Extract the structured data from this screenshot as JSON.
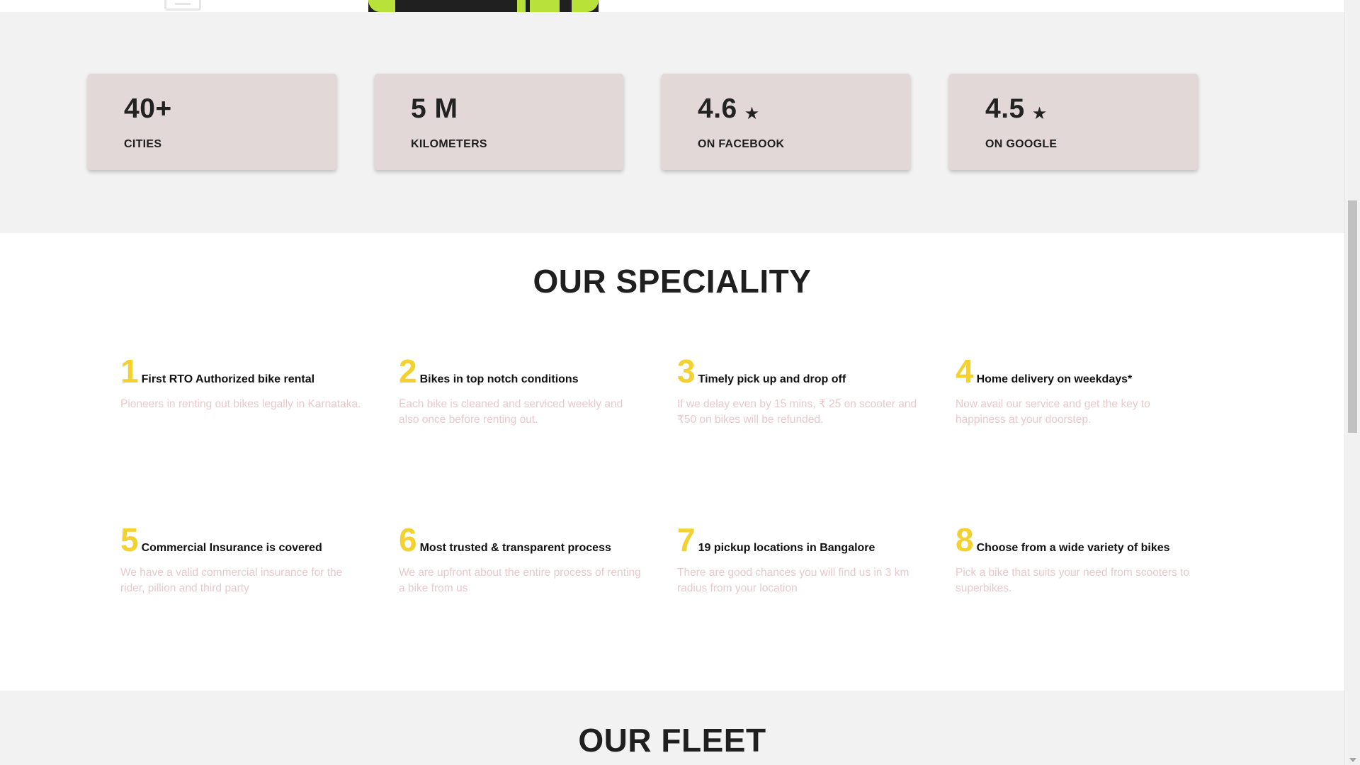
{
  "stats": [
    {
      "value": "40+",
      "label": "CITIES",
      "star": false
    },
    {
      "value": "5 M",
      "label": "KILOMETERS",
      "star": false
    },
    {
      "value": "4.6",
      "label": "ON FACEBOOK",
      "star": true
    },
    {
      "value": "4.5",
      "label": "ON GOOGLE",
      "star": true
    }
  ],
  "star_glyph": "★",
  "speciality": {
    "title": "OUR SPECIALITY",
    "items": [
      {
        "num": "1",
        "title": "First RTO Authorized bike rental",
        "desc": "Pioneers in renting out bikes legally in Karnataka."
      },
      {
        "num": "2",
        "title": "Bikes in top notch conditions",
        "desc": "Each bike is cleaned and serviced weekly and also once before renting out."
      },
      {
        "num": "3",
        "title": "Timely pick up and drop off",
        "desc": "If we delay even by 15 mins, ₹ 25 on scooter and ₹50 on bikes will be refunded."
      },
      {
        "num": "4",
        "title": "Home delivery on weekdays*",
        "desc": "Now avail our service and get the key to happiness at your doorstep."
      },
      {
        "num": "5",
        "title": "Commercial Insurance is covered",
        "desc": "We have a valid commercial insurance for the rider, pillion and third party"
      },
      {
        "num": "6",
        "title": "Most trusted & transparent process",
        "desc": "We are upfront about the entire process of renting a bike from us"
      },
      {
        "num": "7",
        "title": "19 pickup locations in Bangalore",
        "desc": "There are good chances you will find us in 3 km radius from your location"
      },
      {
        "num": "8",
        "title": "Choose from a wide variety of bikes",
        "desc": "Pick a bike that suits your need from scooters to superbikes."
      }
    ]
  },
  "fleet": {
    "title": "OUR FLEET"
  },
  "colors": {
    "accent_number": "#f3d131",
    "card_bg": "#e2d8d8",
    "section_bg": "#f2f2f2",
    "desc_text": "#e8c9cc"
  }
}
